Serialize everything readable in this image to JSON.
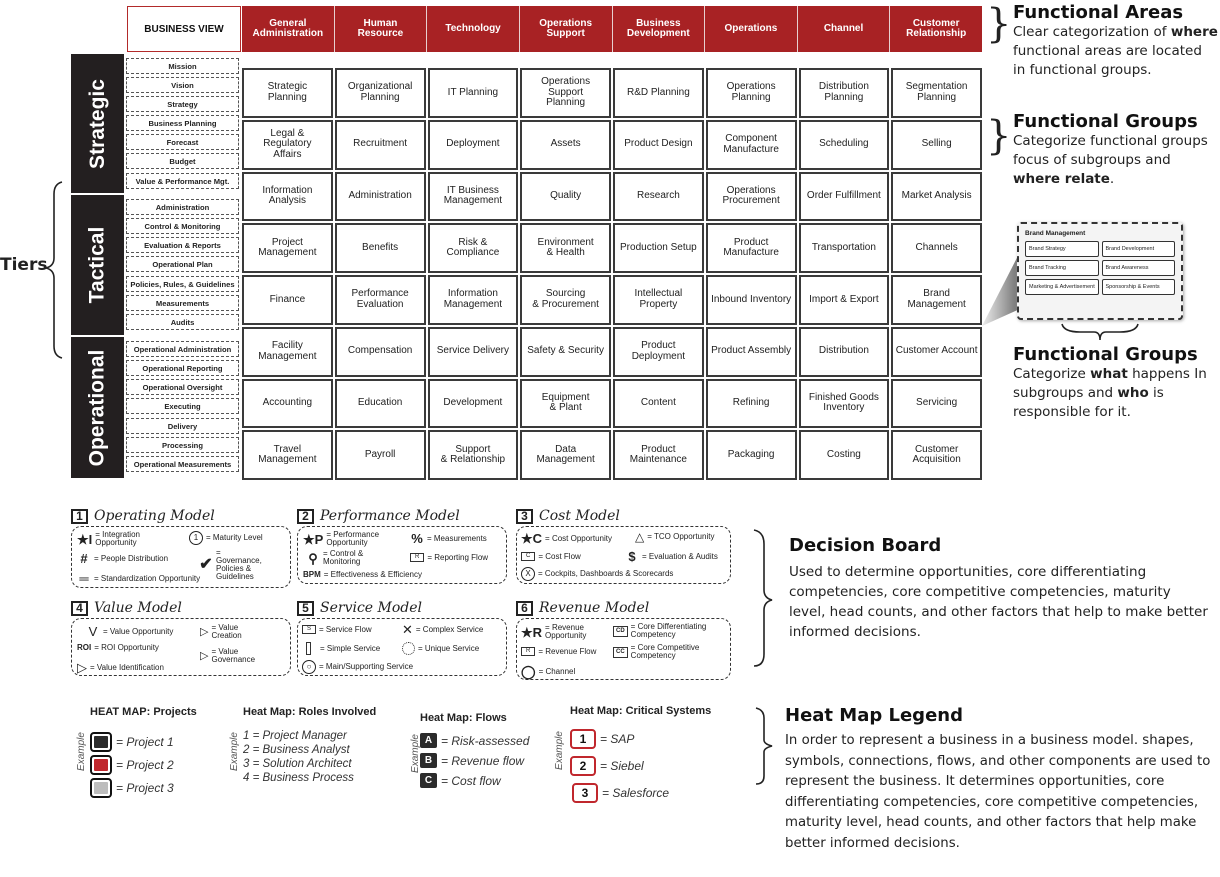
{
  "header": {
    "business_view": "BUSINESS VIEW",
    "areas": [
      "General\nAdministration",
      "Human\nResource",
      "Technology",
      "Operations\nSupport",
      "Business\nDevelopment",
      "Operations",
      "Channel",
      "Customer\nRelationship"
    ],
    "area_color": "#a82224"
  },
  "tiers": {
    "label": "Tiers",
    "items": [
      {
        "name": "Strategic",
        "groups": [
          "Mission",
          "Vision",
          "Strategy",
          "Business Planning",
          "Forecast",
          "Budget",
          "Value & Performance Mgt."
        ]
      },
      {
        "name": "Tactical",
        "groups": [
          "Administration",
          "Control & Monitoring",
          "Evaluation & Reports",
          "Operational Plan",
          "Policies, Rules, & Guidelines",
          "Measurements",
          "Audits"
        ]
      },
      {
        "name": "Operational",
        "groups": [
          "Operational Administration",
          "Operational Reporting",
          "Operational Oversight",
          "Executing",
          "Delivery",
          "Processing",
          "Operational Measurements"
        ]
      }
    ]
  },
  "grid": {
    "rows": [
      [
        "Strategic\nPlanning",
        "Organizational\nPlanning",
        "IT Planning",
        "Operations\nSupport\nPlanning",
        "R&D Planning",
        "Operations\nPlanning",
        "Distribution\nPlanning",
        "Segmentation\nPlanning"
      ],
      [
        "Legal &\nRegulatory\nAffairs",
        "Recruitment",
        "Deployment",
        "Assets",
        "Product Design",
        "Component\nManufacture",
        "Scheduling",
        "Selling"
      ],
      [
        "Information\nAnalysis",
        "Administration",
        "IT Business\nManagement",
        "Quality",
        "Research",
        "Operations\nProcurement",
        "Order Fulfillment",
        "Market Analysis"
      ],
      [
        "Project\nManagement",
        "Benefits",
        "Risk &\nCompliance",
        "Environment\n& Health",
        "Production Setup",
        "Product\nManufacture",
        "Transportation",
        "Channels"
      ],
      [
        "Finance",
        "Performance\nEvaluation",
        "Information\nManagement",
        "Sourcing\n& Procurement",
        "Intellectual\nProperty",
        "Inbound Inventory",
        "Import & Export",
        "Brand\nManagement"
      ],
      [
        "Facility\nManagement",
        "Compensation",
        "Service Delivery",
        "Safety & Security",
        "Product\nDeployment",
        "Product Assembly",
        "Distribution",
        "Customer Account"
      ],
      [
        "Accounting",
        "Education",
        "Development",
        "Equipment\n& Plant",
        "Content",
        "Refining",
        "Finished Goods\nInventory",
        "Servicing"
      ],
      [
        "Travel\nManagement",
        "Payroll",
        "Support\n& Relationship",
        "Data\nManagement",
        "Product\nMaintenance",
        "Packaging",
        "Costing",
        "Customer\nAcquisition"
      ]
    ]
  },
  "annotations": {
    "functional_areas": {
      "title": "Functional  Areas",
      "text_pre": "Clear categorization of ",
      "bold": "where",
      "text_post": " functional areas are located in functional groups."
    },
    "functional_groups_1": {
      "title": "Functional  Groups",
      "text_pre": "Categorize functional groups focus of subgroups and ",
      "bold": "where relate",
      "text_post": "."
    },
    "functional_groups_2": {
      "title": "Functional  Groups",
      "pre": "Categorize ",
      "bold1": "what",
      "mid": " happens In subgroups and ",
      "bold2": "who",
      "post": " is responsible for it."
    },
    "brand_inset": {
      "title": "Brand Management",
      "items": [
        "Brand Strategy",
        "Brand Development",
        "Brand Tracking",
        "Brand Awareness",
        "Marketing & Advertisement",
        "Sponsorship & Events"
      ]
    }
  },
  "models": {
    "operating": {
      "num": "1",
      "title": "Operating Model",
      "items": {
        "integration_sym": "★I",
        "integration": "= Integration Opportunity",
        "maturity_sym": "1",
        "maturity": "= Maturity Level",
        "people_sym": "#",
        "people": "= People Distribution",
        "governance": "= Governance, Policies & Guidelines",
        "standard_sym": "═",
        "standard": "= Standardization Opportunity"
      }
    },
    "performance": {
      "num": "2",
      "title": "Performance Model",
      "items": {
        "perf_sym": "★P",
        "perf": "= Performance Opportunity",
        "meas_sym": "%",
        "meas": "= Measurements",
        "control": "= Control & Monitoring",
        "report_sym": "R",
        "report": "= Reporting Flow",
        "bpm_sym": "BPM",
        "bpm": "= Effectiveness & Efficiency"
      }
    },
    "cost": {
      "num": "3",
      "title": "Cost Model",
      "items": {
        "cost_sym": "★C",
        "cost": "= Cost Opportunity",
        "tco_sym": "TC",
        "tco": "= TCO Opportunity",
        "flow_sym": "C",
        "flow": "= Cost Flow",
        "eval_sym": "$",
        "eval": "= Evaluation & Audits",
        "cockpit_sym": "X",
        "cockpit": "= Cockpits, Dashboards & Scorecards"
      }
    },
    "value": {
      "num": "4",
      "title": "Value Model",
      "items": {
        "v_sym": "V",
        "v": "= Value Opportunity",
        "creation_sym": "c",
        "creation": "= Value Creation",
        "roi_sym": "ROI",
        "roi": "= ROI Opportunity",
        "gov_sym": "G",
        "gov": "= Value Governance",
        "ident": "= Value Identification"
      }
    },
    "service": {
      "num": "5",
      "title": "Service Model",
      "items": {
        "flow_sym": "S",
        "flow": "= Service Flow",
        "complex": "= Complex Service",
        "simple": "= Simple Service",
        "unique": "= Unique Service",
        "main": "= Main/Supporting Service"
      }
    },
    "revenue": {
      "num": "6",
      "title": "Revenue Model",
      "items": {
        "rev_sym": "★R",
        "rev": "= Revenue Opportunity",
        "cd_sym": "CD",
        "cd": "= Core Differentiating Competency",
        "flow_sym": "R",
        "flow": "= Revenue Flow",
        "cc_sym": "CC",
        "cc": "= Core Competitive Competency",
        "channel": "= Channel"
      }
    }
  },
  "decision_board": {
    "title": "Decision Board",
    "text": "Used to determine opportunities, core differentiating competencies, core competitive competencies, maturity level, head counts, and other factors that help to make better informed decisions."
  },
  "heatmap": {
    "example_label": "Example",
    "projects": {
      "title": "HEAT MAP: Projects",
      "items": [
        {
          "label": "= Project 1",
          "color": "#2b2b2b"
        },
        {
          "label": "= Project 2",
          "color": "#c0272d"
        },
        {
          "label": "= Project 3",
          "color": "#bdbdbd"
        }
      ]
    },
    "roles": {
      "title": "Heat Map: Roles Involved",
      "items": [
        "1 = Project Manager",
        "2 = Business Analyst",
        "3 = Solution Architect",
        "4 = Business Process"
      ]
    },
    "flows": {
      "title": "Heat Map: Flows",
      "items": [
        {
          "key": "A",
          "label": "= Risk-assessed"
        },
        {
          "key": "B",
          "label": "= Revenue flow"
        },
        {
          "key": "C",
          "label": "= Cost flow"
        }
      ]
    },
    "critical": {
      "title": "Heat Map: Critical Systems",
      "items": [
        {
          "key": "1",
          "label": "= SAP"
        },
        {
          "key": "2",
          "label": "= Siebel"
        },
        {
          "key": "3",
          "label": "= Salesforce"
        }
      ]
    }
  },
  "heatmap_legend": {
    "title": "Heat Map Legend",
    "text": "In order to represent a business in a business model. shapes, symbols, connections, flows, and other components are used to represent the business. It determines opportunities, core differentiating competencies, core competitive competencies, maturity level, head counts, and other factors that help make better informed decisions."
  }
}
